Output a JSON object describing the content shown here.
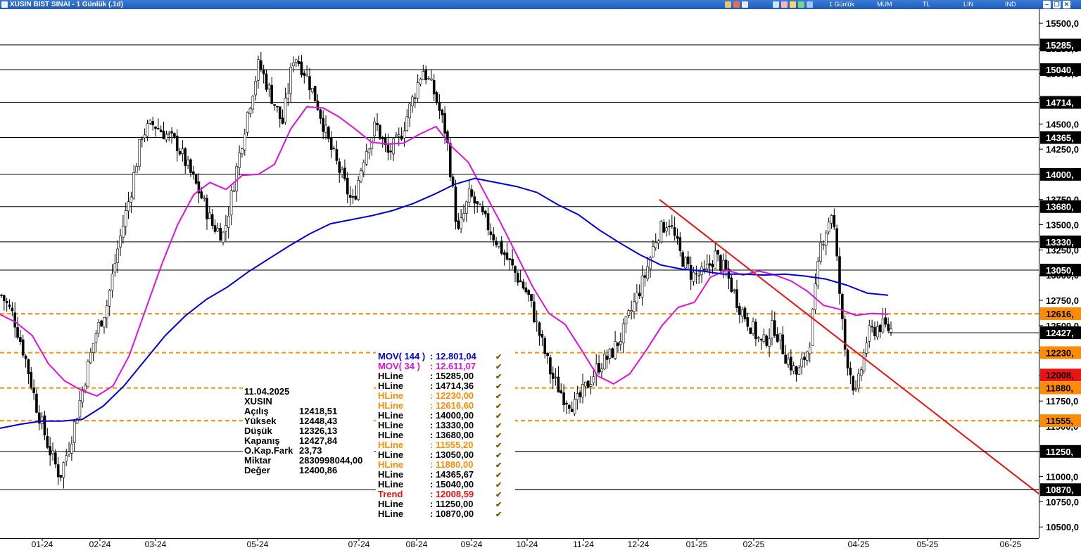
{
  "window": {
    "title": "XUSIN BIST SINAI - 1 Günlük (.1d)",
    "toolbar": [
      "1 Günlük",
      "MUM",
      "TL",
      "LIN",
      "IND"
    ]
  },
  "chart_data": {
    "type": "candlestick",
    "symbol": "XUSIN",
    "ylim": [
      10390,
      15640
    ],
    "y_ticks": [
      10500,
      10750,
      11000,
      11250,
      11500,
      11750,
      12000,
      12250,
      12500,
      12750,
      13000,
      13250,
      13500,
      13750,
      14000,
      14250,
      14500,
      14750,
      15000,
      15250,
      15500
    ],
    "y_tick_labels": [
      "10500,0",
      "10750,0",
      "11000,0",
      "11250,0",
      "11500,0",
      "11750,0",
      "12000,0",
      "12250,0",
      "12500,0",
      "12750,0",
      "13000,0",
      "13250,0",
      "13500,0",
      "13750,0",
      "14000,0",
      "14250,0",
      "14500,0",
      "14750,0",
      "15000,0",
      "15250,0",
      "15500,0"
    ],
    "x_tick_labels": [
      "01-24",
      "02-24",
      "03-24",
      "05-24",
      "07-24",
      "08-24",
      "09-24",
      "10-24",
      "11-24",
      "12-24",
      "01-25",
      "02-25",
      "04-25",
      "05-25",
      "06-25"
    ],
    "last_price_label": "12427,",
    "hlines": [
      {
        "value": 15285.0,
        "label": "15285,",
        "style": "solid"
      },
      {
        "value": 15040.0,
        "label": "15040,",
        "style": "solid"
      },
      {
        "value": 14714.36,
        "label": "14714,",
        "style": "solid"
      },
      {
        "value": 14365.67,
        "label": "14365,",
        "style": "solid"
      },
      {
        "value": 14000.0,
        "label": "14000,",
        "style": "solid"
      },
      {
        "value": 13680.0,
        "label": "13680,",
        "style": "solid"
      },
      {
        "value": 13330.0,
        "label": "13330,",
        "style": "solid"
      },
      {
        "value": 13050.0,
        "label": "13050,",
        "style": "solid"
      },
      {
        "value": 12616.6,
        "label": "12616,",
        "style": "dashed"
      },
      {
        "value": 12230.0,
        "label": "12230,",
        "style": "dashed"
      },
      {
        "value": 11880.0,
        "label": "11880,",
        "style": "dashed"
      },
      {
        "value": 11555.2,
        "label": "11555,",
        "style": "dashed"
      },
      {
        "value": 11250.0,
        "label": "11250,",
        "style": "solid"
      },
      {
        "value": 10870.0,
        "label": "10870,",
        "style": "solid"
      }
    ],
    "trend": {
      "value": 12008.59,
      "label": "12008,",
      "start_value": 13750,
      "end_value": 10830
    },
    "mov_short_series": [
      12610,
      12530,
      12400,
      12120,
      11950,
      11860,
      11800,
      11900,
      12200,
      12650,
      13100,
      13500,
      13800,
      13920,
      13850,
      13990,
      14000,
      14100,
      14450,
      14670,
      14660,
      14570,
      14450,
      14320,
      14300,
      14310,
      14400,
      14475,
      14270,
      14120,
      13820,
      13520,
      13200,
      12880,
      12620,
      12510,
      12260,
      12000,
      11920,
      12020,
      12250,
      12500,
      12680,
      12730,
      12980,
      13050,
      13000,
      13040,
      13000,
      12940,
      12840,
      12700,
      12660,
      12600,
      12620,
      12611
    ],
    "mov_long_series": [
      11480,
      11520,
      11550,
      11550,
      11570,
      11700,
      11900,
      12150,
      12400,
      12600,
      12760,
      12880,
      13030,
      13160,
      13290,
      13410,
      13510,
      13550,
      13590,
      13640,
      13710,
      13800,
      13900,
      13960,
      13920,
      13880,
      13820,
      13700,
      13600,
      13450,
      13320,
      13200,
      13100,
      13060,
      13040,
      13010,
      13010,
      13000,
      13010,
      12990,
      12960,
      12900,
      12820,
      12801
    ],
    "legend": [
      {
        "label": "MOV( 144 )",
        "value": ": 12.801,04",
        "color": "#0000dd"
      },
      {
        "label": "MOV( 34 )",
        "value": ": 12.611,07",
        "color": "#e010e0"
      },
      {
        "label": "HLine",
        "value": ": 15285,00",
        "color": "#000000"
      },
      {
        "label": "HLine",
        "value": ": 14714,36",
        "color": "#000000"
      },
      {
        "label": "HLine",
        "value": ": 12230,00",
        "color": "#ff8c00"
      },
      {
        "label": "HLine",
        "value": ": 12616,60",
        "color": "#ff8c00"
      },
      {
        "label": "HLine",
        "value": ": 14000,00",
        "color": "#000000"
      },
      {
        "label": "HLine",
        "value": ": 13330,00",
        "color": "#000000"
      },
      {
        "label": "HLine",
        "value": ": 13680,00",
        "color": "#000000"
      },
      {
        "label": "HLine",
        "value": ": 11555,20",
        "color": "#ff8c00"
      },
      {
        "label": "HLine",
        "value": ": 13050,00",
        "color": "#000000"
      },
      {
        "label": "HLine",
        "value": ": 11880,00",
        "color": "#ff8c00"
      },
      {
        "label": "HLine",
        "value": ": 14365,67",
        "color": "#000000"
      },
      {
        "label": "HLine",
        "value": ": 15040,00",
        "color": "#000000"
      },
      {
        "label": "Trend",
        "value": ": 12008,59",
        "color": "#ee1111"
      },
      {
        "label": "HLine",
        "value": ": 11250,00",
        "color": "#000000"
      },
      {
        "label": "HLine",
        "value": ": 10870,00",
        "color": "#000000"
      }
    ],
    "info": {
      "date": "11.04.2025",
      "symbol": "XUSIN",
      "rows": [
        {
          "label": "Açılış",
          "value": "12418,51"
        },
        {
          "label": "Yüksek",
          "value": "12448,43"
        },
        {
          "label": "Düşük",
          "value": "12326,13"
        },
        {
          "label": "Kapanış",
          "value": "12427,84"
        },
        {
          "label": "O.Kap.Fark",
          "value": "23,73"
        },
        {
          "label": "Miktar",
          "value": "2830998044,00"
        },
        {
          "label": "Değer",
          "value": "12400,86"
        }
      ]
    },
    "price_path": [
      12800,
      12600,
      12200,
      11700,
      11300,
      11000,
      11400,
      11900,
      12400,
      12700,
      13300,
      13800,
      14400,
      14500,
      14400,
      14300,
      14050,
      13800,
      13500,
      13400,
      14000,
      14600,
      15100,
      14800,
      14500,
      15200,
      15000,
      14700,
      14300,
      14000,
      13700,
      14200,
      14500,
      14200,
      14350,
      14700,
      15050,
      14800,
      14400,
      13400,
      13800,
      13600,
      13400,
      13200,
      13000,
      12800,
      12400,
      12000,
      11800,
      11700,
      11900,
      12100,
      12200,
      12400,
      12700,
      13000,
      13400,
      13550,
      13200,
      13000,
      13000,
      13200,
      13000,
      12700,
      12500,
      12300,
      12500,
      12200,
      12000,
      12300,
      13300,
      13650,
      12300,
      11800,
      12400,
      12500,
      12460
    ]
  }
}
